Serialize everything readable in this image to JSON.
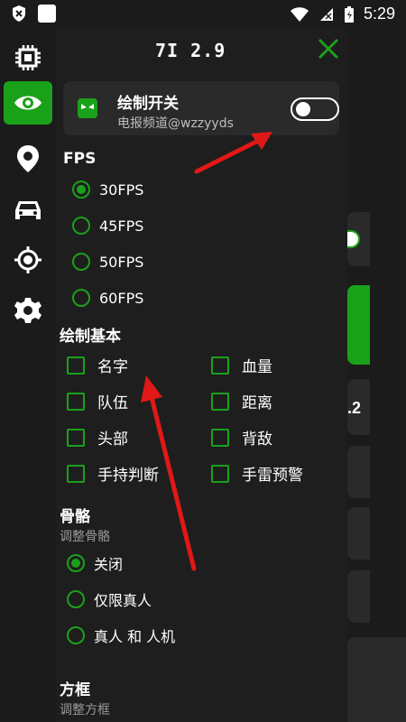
{
  "status": {
    "time": "5:29"
  },
  "panel": {
    "title": "7I 2.9",
    "card": {
      "title": "绘制开关",
      "subtitle": "电报频道@wzzyyds",
      "toggle_on": false
    }
  },
  "fps": {
    "label": "FPS",
    "options": [
      "30FPS",
      "45FPS",
      "50FPS",
      "60FPS"
    ],
    "selected": "30FPS"
  },
  "draw_basic": {
    "label": "绘制基本",
    "items": [
      {
        "label": "名字",
        "checked": false
      },
      {
        "label": "血量",
        "checked": false
      },
      {
        "label": "队伍",
        "checked": false
      },
      {
        "label": "距离",
        "checked": false
      },
      {
        "label": "头部",
        "checked": false
      },
      {
        "label": "背敌",
        "checked": false
      },
      {
        "label": "手持判断",
        "checked": false
      },
      {
        "label": "手雷预警",
        "checked": false
      }
    ]
  },
  "skeleton": {
    "label": "骨骼",
    "subtitle": "调整骨骼",
    "options": [
      "关闭",
      "仅限真人",
      "真人 和 人机"
    ],
    "selected": "关闭"
  },
  "box": {
    "label": "方框",
    "subtitle": "调整方框"
  },
  "peek": {
    "text": ".2"
  },
  "colors": {
    "accent": "#1aa11a",
    "panel": "#1e1e1e",
    "card": "#2a2a2a",
    "arrow": "#e01818"
  },
  "icons": [
    "chip-icon",
    "eye-icon",
    "location-icon",
    "car-icon",
    "crosshair-icon",
    "gear-icon"
  ]
}
